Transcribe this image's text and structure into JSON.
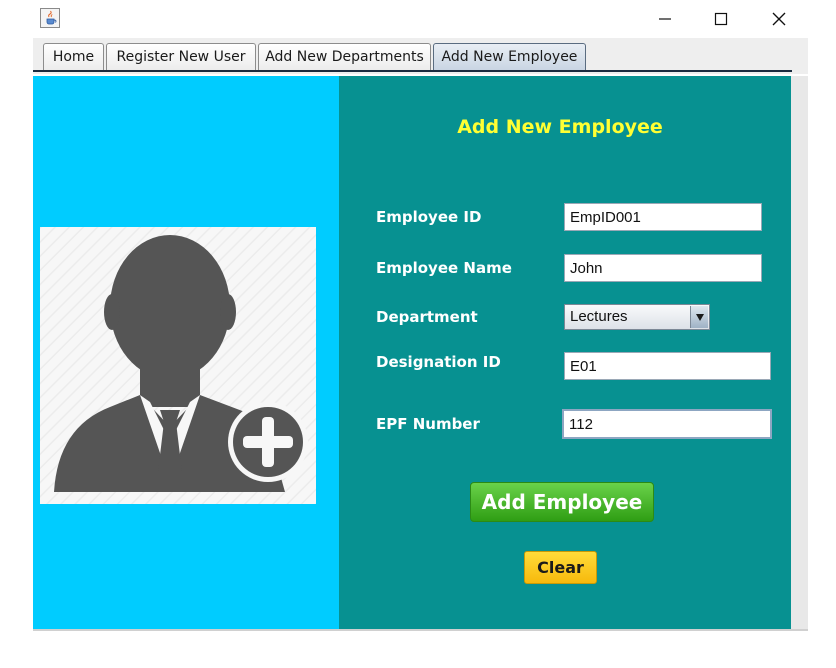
{
  "window": {
    "app_icon": "java-cup-icon",
    "controls": {
      "minimize": "minimize-icon",
      "maximize": "maximize-icon",
      "close": "close-icon"
    }
  },
  "tabs": [
    {
      "label": "Home",
      "active": false
    },
    {
      "label": "Register New User",
      "active": false
    },
    {
      "label": "Add New Departments",
      "active": false
    },
    {
      "label": "Add New Employee",
      "active": true
    }
  ],
  "form": {
    "title": "Add New Employee",
    "employee_id": {
      "label": "Employee ID",
      "value": "EmpID001"
    },
    "employee_name": {
      "label": "Employee Name",
      "value": "John"
    },
    "department": {
      "label": "Department",
      "selected": "Lectures"
    },
    "designation_id": {
      "label": "Designation ID",
      "value": "E01"
    },
    "epf_number": {
      "label": "EPF Number",
      "value": "112"
    },
    "add_button": "Add Employee",
    "clear_button": "Clear"
  },
  "image": {
    "icon": "add-user-icon"
  },
  "colors": {
    "left_panel": "#00ccff",
    "right_panel": "#079191",
    "title_text": "#ffff33",
    "add_button": "#3fb21f",
    "clear_button": "#fcc81e"
  }
}
